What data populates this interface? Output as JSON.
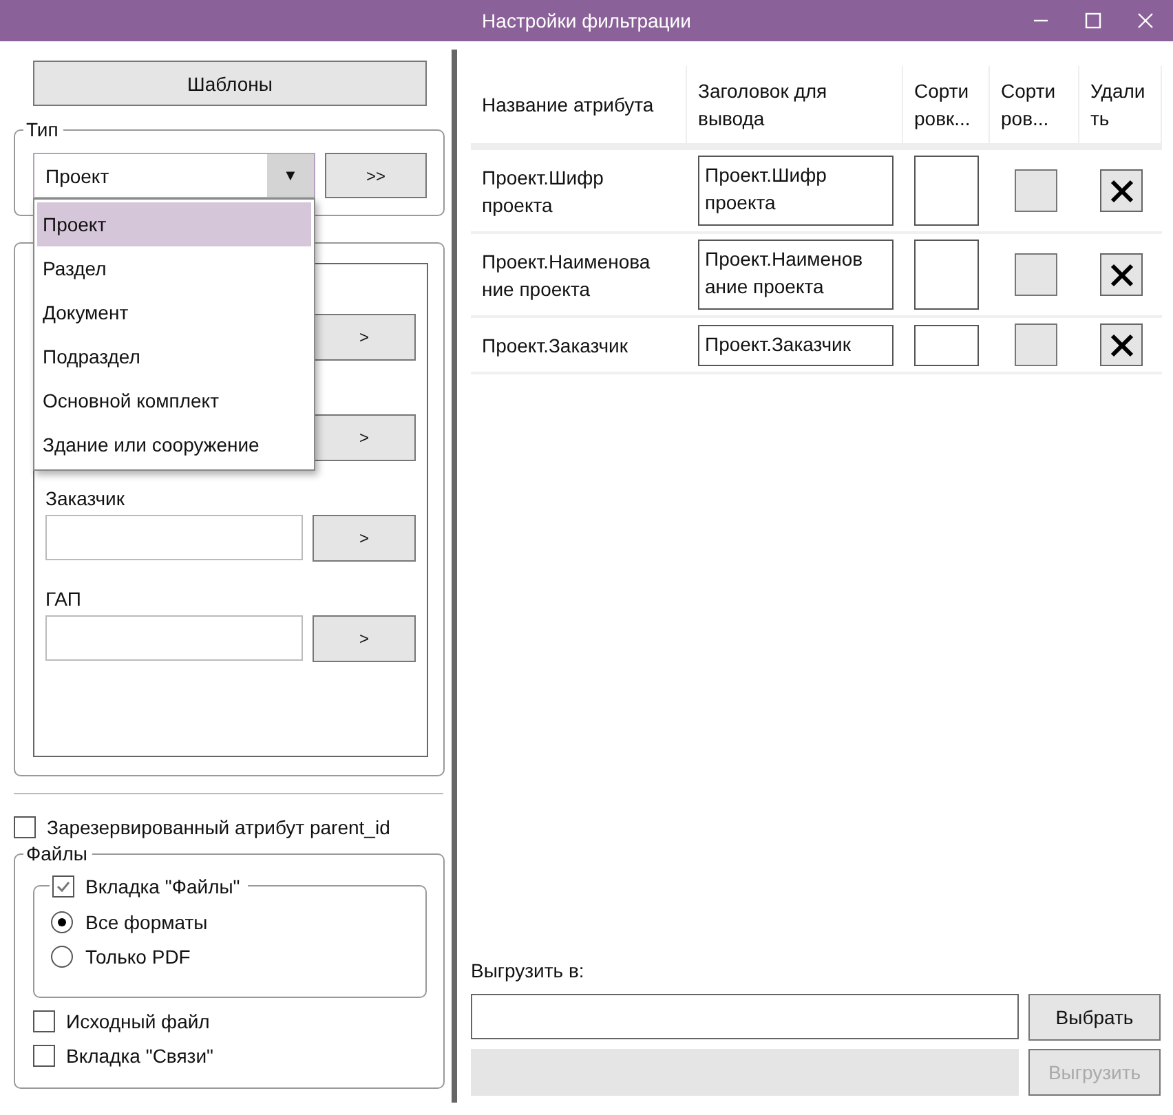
{
  "window": {
    "title": "Настройки фильтрации"
  },
  "templates_button": "Шаблоны",
  "type_group": {
    "legend": "Тип",
    "combo": {
      "value": "Проект",
      "expanded": true,
      "arrow": "▼"
    },
    "apply_button": ">>",
    "options": [
      {
        "label": "Проект",
        "selected": true
      },
      {
        "label": "Раздел",
        "selected": false
      },
      {
        "label": "Документ",
        "selected": false
      },
      {
        "label": "Подраздел",
        "selected": false
      },
      {
        "label": "Основной комплект",
        "selected": false
      },
      {
        "label": "Здание или сооружение",
        "selected": false
      }
    ]
  },
  "attribute_fields": [
    {
      "button": ">"
    },
    {
      "button": ">"
    },
    {
      "label": "Заказчик",
      "button": ">"
    },
    {
      "label": "ГАП",
      "button": ">"
    }
  ],
  "reserved_attribute": {
    "label": "Зарезервированный атрибут parent_id",
    "checked": false
  },
  "files_group": {
    "legend": "Файлы",
    "files_tab": {
      "label": "Вкладка \"Файлы\"",
      "checked": true
    },
    "formats": [
      {
        "label": "Все форматы",
        "selected": true
      },
      {
        "label": "Только PDF",
        "selected": false
      }
    ],
    "options": [
      {
        "label": "Исходный файл",
        "checked": false
      },
      {
        "label": "Вкладка \"Связи\"",
        "checked": false
      }
    ]
  },
  "table": {
    "columns": [
      {
        "lines": [
          "Название атрибута"
        ]
      },
      {
        "lines": [
          "Заголовок для",
          "вывода"
        ]
      },
      {
        "lines": [
          "Сорти",
          "ровк..."
        ]
      },
      {
        "lines": [
          "Сорти",
          "ров..."
        ]
      },
      {
        "lines": [
          "Удали",
          "ть"
        ]
      }
    ],
    "rows": [
      {
        "name": [
          "Проект.Шифр",
          "проекта"
        ],
        "caption": [
          "Проект.Шифр",
          "проекта"
        ],
        "sort_checked": false
      },
      {
        "name": [
          "Проект.Наименова",
          "ние проекта"
        ],
        "caption": [
          "Проект.Наименов",
          "ание проекта"
        ],
        "sort_checked": false
      },
      {
        "name": [
          "Проект.Заказчик"
        ],
        "caption": [
          "Проект.Заказчик"
        ],
        "sort_checked": false
      }
    ]
  },
  "export": {
    "label": "Выгрузить в:",
    "choose_button": "Выбрать",
    "export_button": {
      "label": "Выгрузить",
      "disabled": true
    },
    "progress": {
      "level": 0
    }
  }
}
